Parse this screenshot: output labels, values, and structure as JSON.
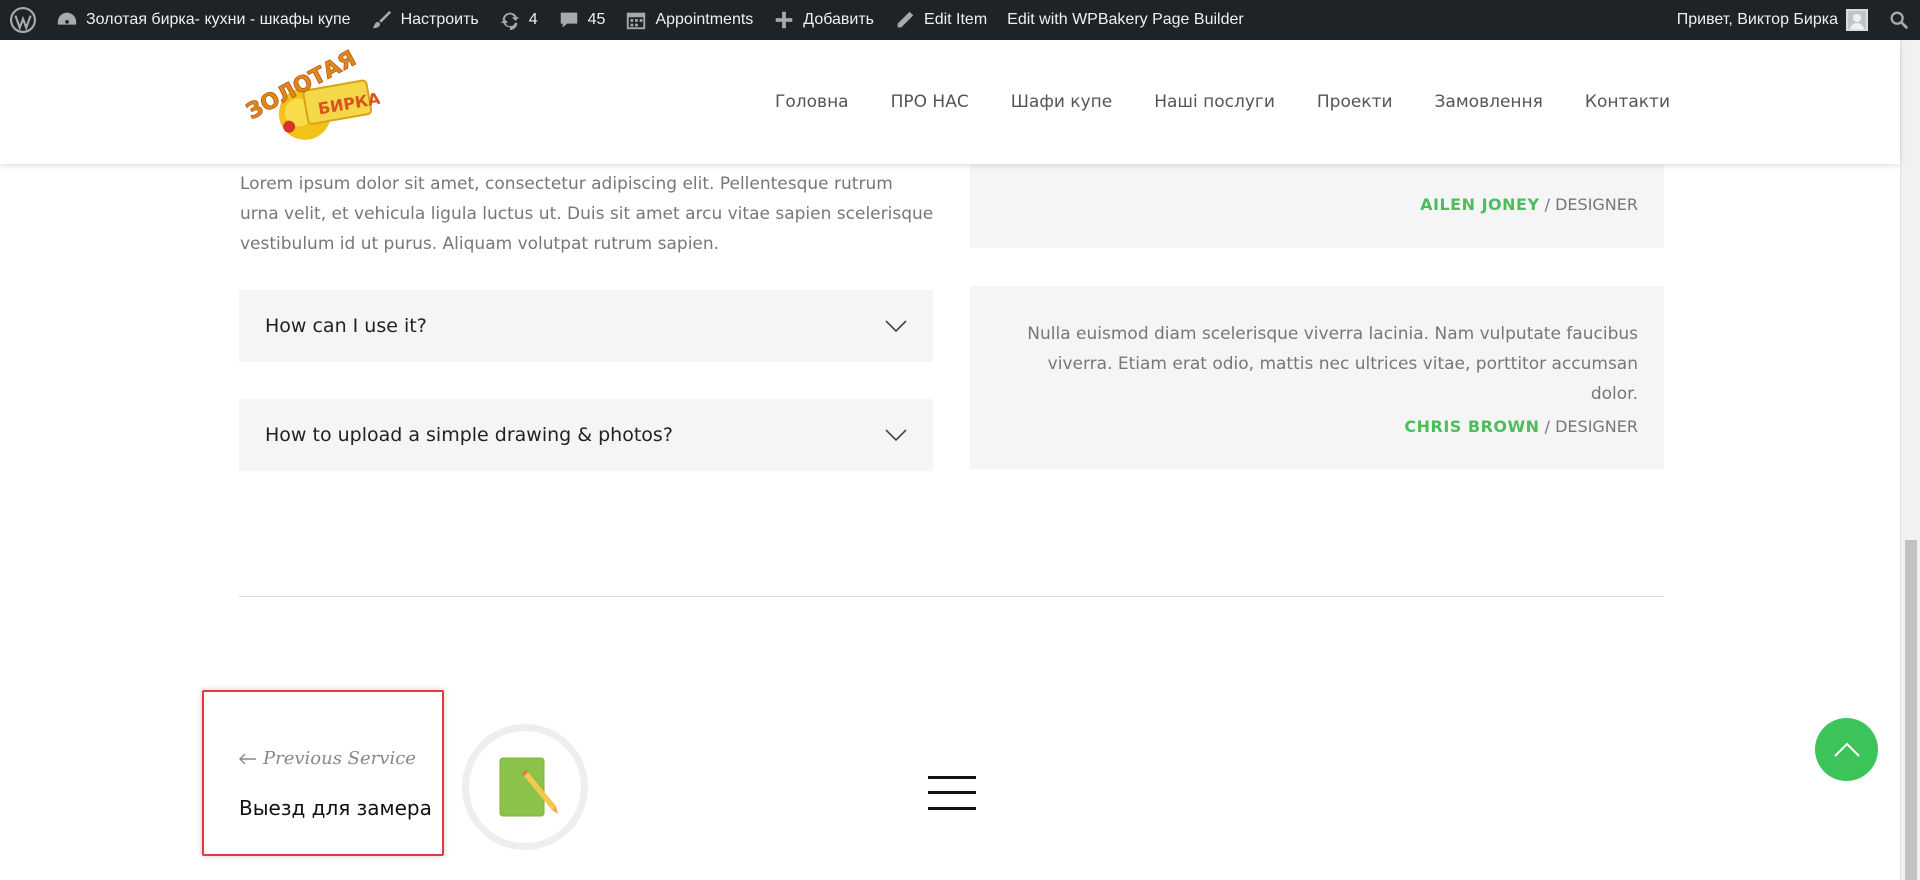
{
  "admin_bar": {
    "site_name": "Золотая бирка- кухни - шкафы купе",
    "customize": "Настроить",
    "updates_count": "4",
    "comments_count": "45",
    "appointments": "Appointments",
    "add_new": "Добавить",
    "edit_item": "Edit Item",
    "wpbakery": "Edit with WPBakery Page Builder",
    "greeting": "Привет, Виктор Бирка"
  },
  "nav": {
    "items": [
      "Головна",
      "ПРО НАС",
      "Шафи купе",
      "Наші послуги",
      "Проекти",
      "Замовлення",
      "Контакти"
    ]
  },
  "faq": {
    "answer_text": "Lorem ipsum dolor sit amet, consectetur adipiscing elit. Pellentesque rutrum urna velit, et vehicula ligula luctus ut. Duis sit amet arcu vitae sapien scelerisque vestibulum id ut purus. Aliquam volutpat rutrum sapien.",
    "questions": [
      "How can I use it?",
      "How to upload a simple drawing & photos?"
    ]
  },
  "testimonials": [
    {
      "quote": "",
      "name": "AILEN JONEY",
      "role": "/ DESIGNER"
    },
    {
      "quote": "Nulla euismod diam scelerisque viverra lacinia. Nam vulputate faucibus viverra. Etiam erat odio, mattis nec ultrices vitae, porttitor accumsan dolor.",
      "name": "CHRIS BROWN",
      "role": "/ DESIGNER"
    }
  ],
  "post_nav": {
    "prev_label": "Previous Service",
    "prev_title": "Выезд для замера"
  },
  "colors": {
    "accent_green": "#4cbc5c",
    "to_top_green": "#3cc45a",
    "admin_bar_bg": "#1d2327",
    "highlight_red": "#e0393e"
  }
}
